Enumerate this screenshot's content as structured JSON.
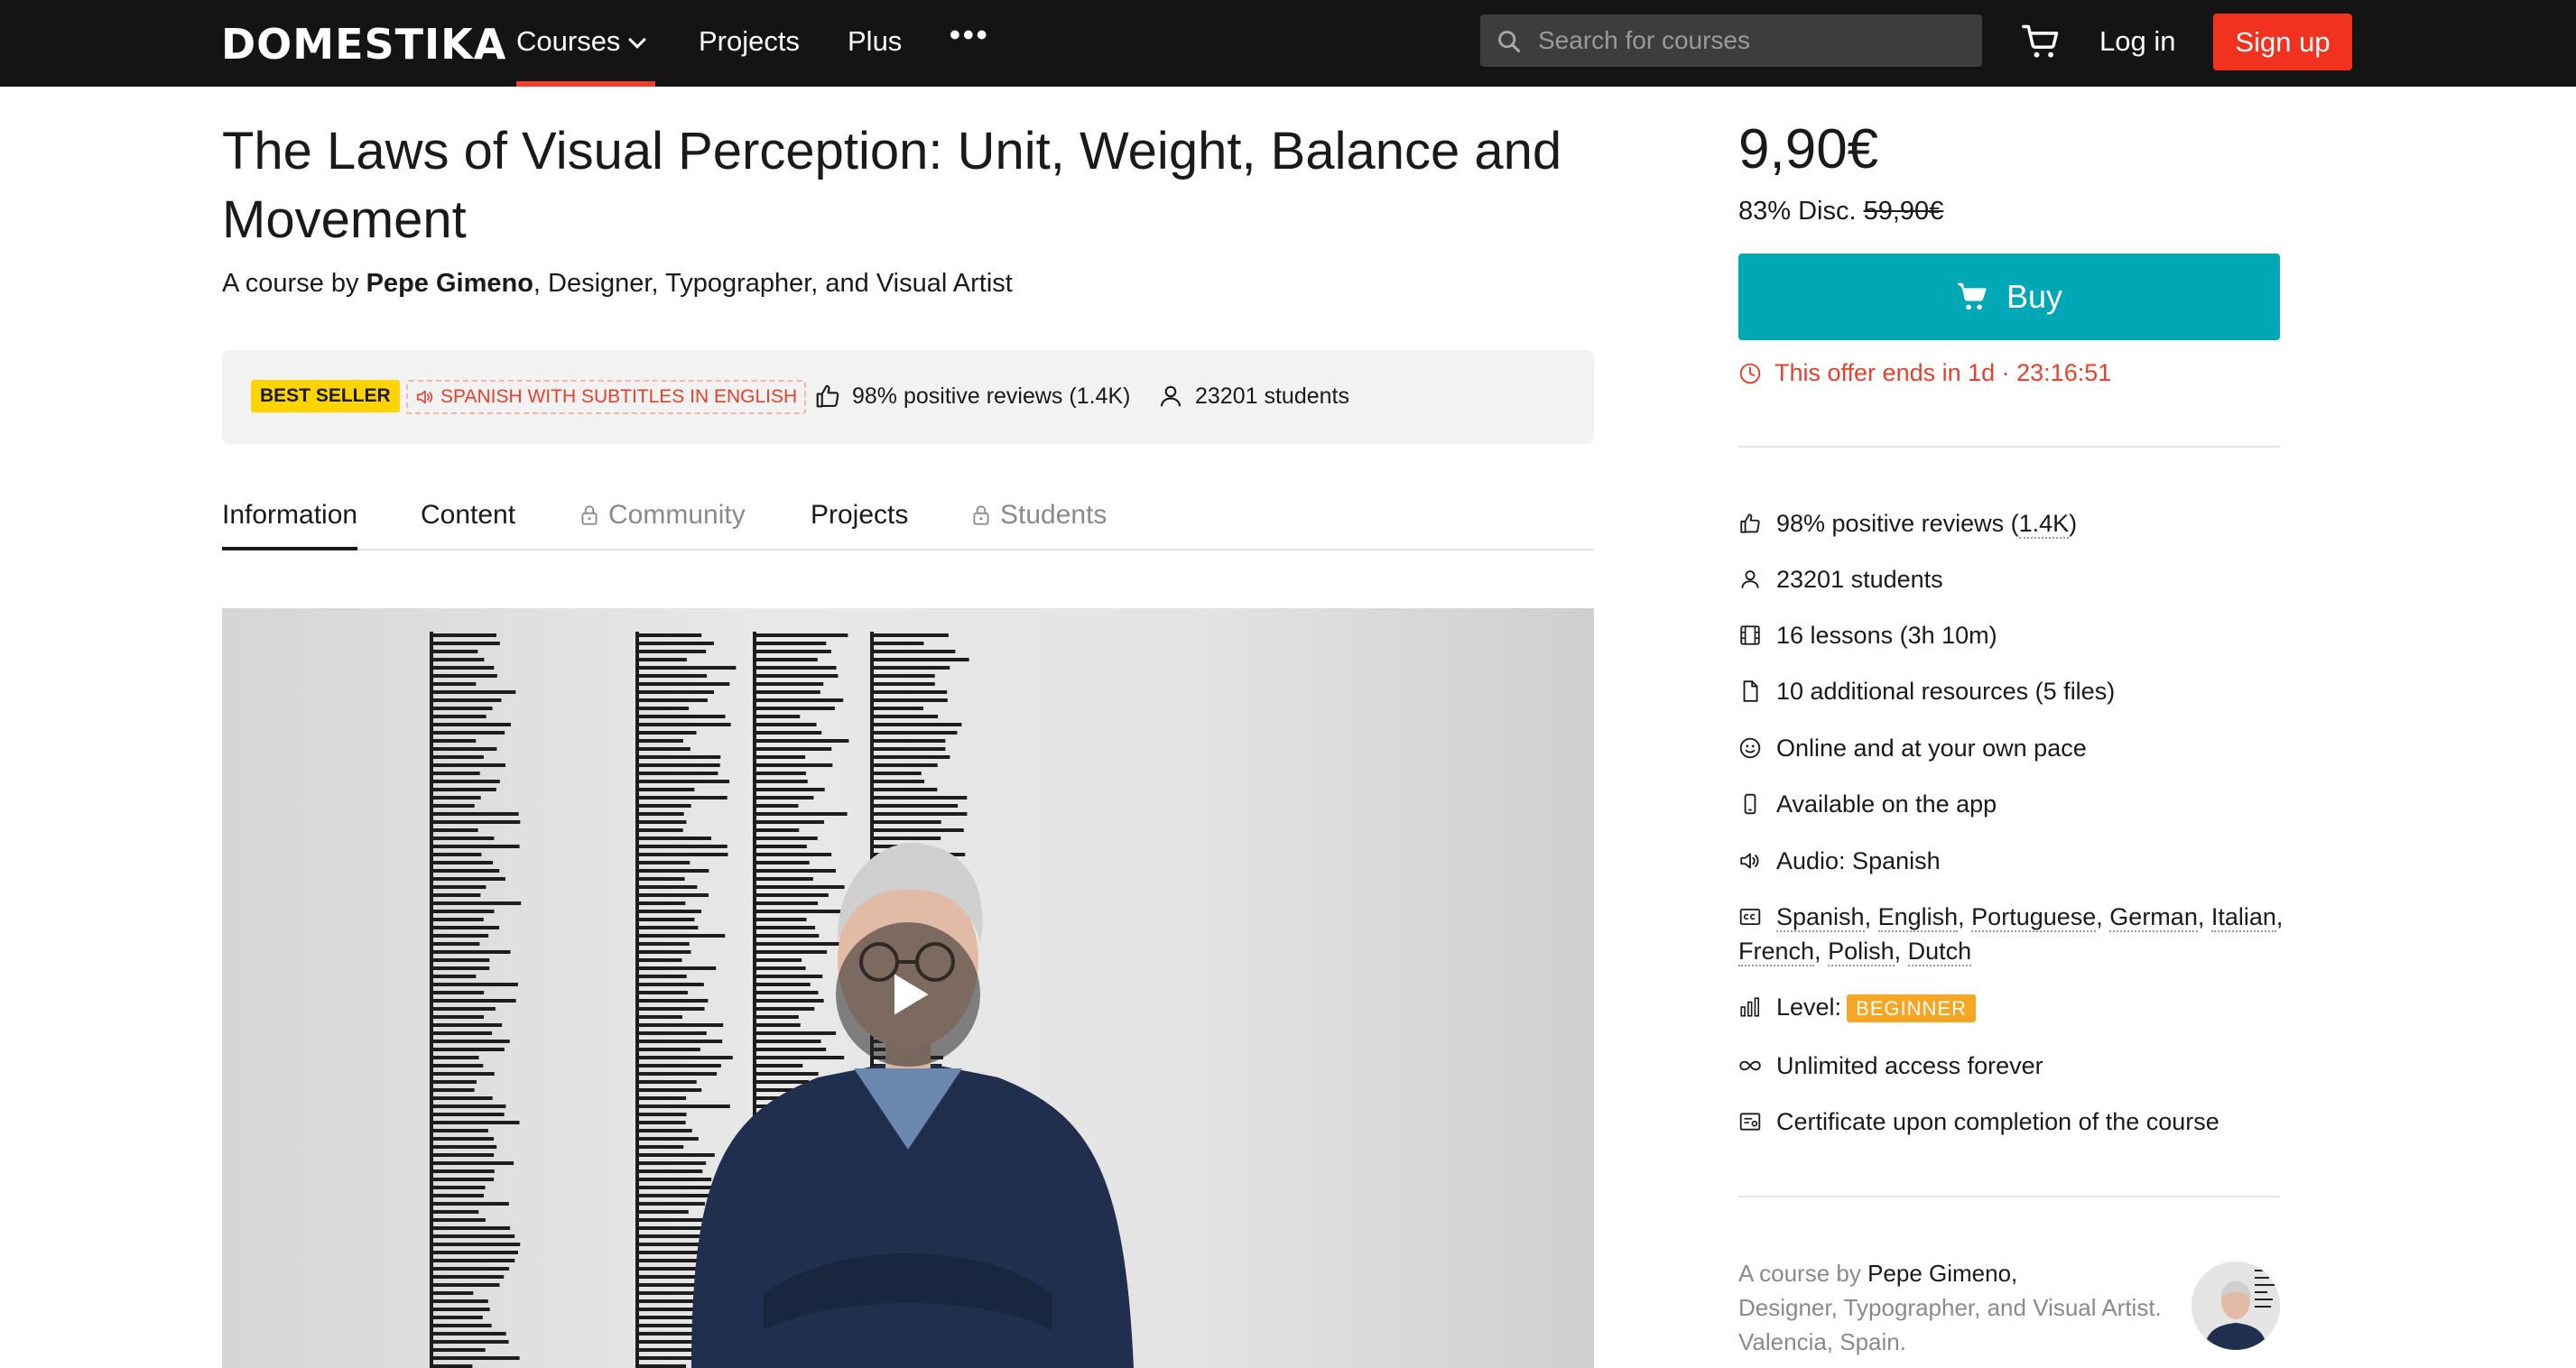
{
  "brand": {
    "logo_text": "DOMESTIKA",
    "accent_color": "#e8402d",
    "signup_color": "#f0321f",
    "buy_color": "#00a7b5"
  },
  "nav": {
    "courses_label": "Courses",
    "projects_label": "Projects",
    "plus_label": "Plus",
    "more_label": "•••",
    "search_placeholder": "Search for courses",
    "login_label": "Log in",
    "signup_label": "Sign up"
  },
  "course": {
    "title": "The Laws of Visual Perception: Unit, Weight, Balance and Movement",
    "byline_prefix": "A course by ",
    "author": "Pepe Gimeno",
    "byline_suffix": ", Designer, Typographer, and Visual Artist",
    "badge_best": "BEST SELLER",
    "badge_lang": "SPANISH WITH SUBTITLES IN ENGLISH",
    "reviews": "98% positive reviews (1.4K)",
    "students": "23201 students"
  },
  "tabs": [
    {
      "label": "Information",
      "locked": false,
      "active": true
    },
    {
      "label": "Content",
      "locked": false,
      "active": false
    },
    {
      "label": "Community",
      "locked": true,
      "active": false
    },
    {
      "label": "Projects",
      "locked": false,
      "active": false
    },
    {
      "label": "Students",
      "locked": true,
      "active": false
    }
  ],
  "purchase": {
    "price": "9,90€",
    "discount_label": "83% Disc. ",
    "old_price": "59,90€",
    "buy_label": "Buy",
    "offer_text": "This offer ends in 1d · 23:16:51"
  },
  "features": {
    "reviews_prefix": "98% positive reviews (",
    "reviews_link": "1.4K",
    "reviews_suffix": ")",
    "students": "23201 students",
    "lessons": "16 lessons (3h 10m)",
    "resources": "10 additional resources (5 files)",
    "online": "Online and at your own pace",
    "app": "Available on the app",
    "audio": "Audio: Spanish",
    "subtitles": [
      "Spanish",
      "English",
      "Portuguese",
      "German",
      "Italian",
      "French",
      "Polish",
      "Dutch"
    ],
    "level_label": "Level:",
    "level_value": "BEGINNER",
    "access": "Unlimited access forever",
    "certificate": "Certificate upon completion of the course"
  },
  "teacher": {
    "prefix": "A course by ",
    "name": "Pepe Gimeno,",
    "line2": "Designer, Typographer, and Visual Artist.",
    "line3": "Valencia, Spain."
  },
  "icons": [
    "search-icon",
    "cart-icon",
    "chevron-down-icon",
    "speaker-icon",
    "thumbs-up-icon",
    "user-icon",
    "lock-icon",
    "play-icon",
    "clock-icon",
    "film-icon",
    "file-icon",
    "smile-icon",
    "phone-icon",
    "captions-icon",
    "bar-chart-icon",
    "infinity-icon",
    "certificate-icon"
  ]
}
